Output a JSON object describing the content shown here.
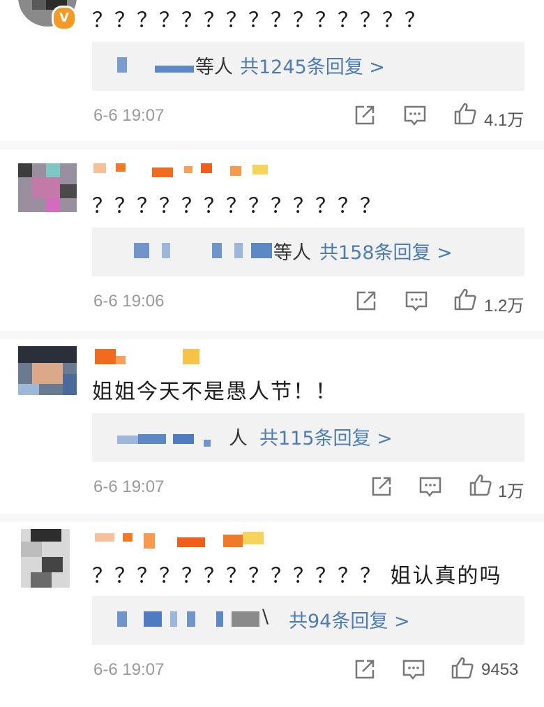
{
  "comments": [
    {
      "text": "？？？？？？？？？？？？？？？",
      "reply_trail": "等人",
      "reply_link": "共1245条回复 >",
      "time": "6-6 19:07",
      "likes": "4.1万",
      "verified_badge": "V"
    },
    {
      "text": "？？？？？？？？？？？？？",
      "reply_trail": "等人",
      "reply_link": "共158条回复 >",
      "time": "6-6 19:06",
      "likes": "1.2万"
    },
    {
      "text": "姐姐今天不是愚人节！！",
      "reply_trail": "人",
      "reply_link": "共115条回复 >",
      "time": "6-6 19:07",
      "likes": "1万"
    },
    {
      "text": "？？？？？？？？？？？？？ 姐认真的吗",
      "reply_trail": "\\",
      "reply_link": "共94条回复 >",
      "time": "6-6 19:07",
      "likes": "9453"
    }
  ],
  "icons": {
    "share": "share-icon",
    "comment": "comment-icon",
    "like": "thumbs-up-icon"
  },
  "colors": {
    "link": "#4d7cb4",
    "badge": "#f39a24",
    "reply_bg": "#f2f2f2",
    "time": "#9a9a9a"
  }
}
